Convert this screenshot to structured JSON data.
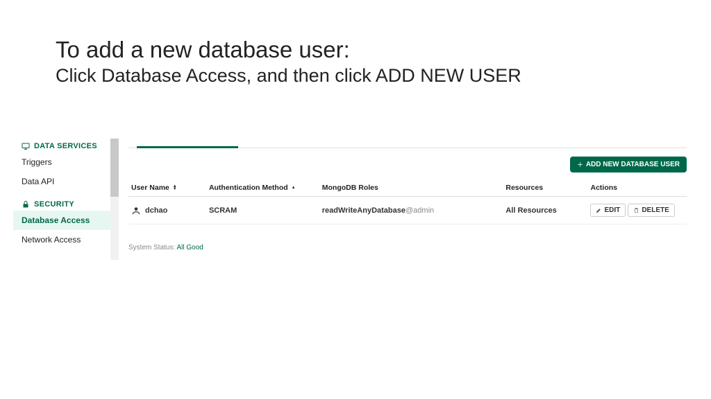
{
  "slide": {
    "title": "To add a new database user:",
    "subtitle": "Click Database Access, and then click ADD NEW USER"
  },
  "sidebar": {
    "sections": [
      {
        "label": "DATA SERVICES",
        "icon": "monitor",
        "items": [
          {
            "label": "Triggers",
            "active": false
          },
          {
            "label": "Data API",
            "active": false
          }
        ]
      },
      {
        "label": "SECURITY",
        "icon": "lock",
        "items": [
          {
            "label": "Database Access",
            "active": true
          },
          {
            "label": "Network Access",
            "active": false
          }
        ]
      }
    ]
  },
  "main": {
    "add_button": "ADD NEW DATABASE USER",
    "columns": {
      "user": "User Name",
      "auth": "Authentication Method",
      "roles": "MongoDB Roles",
      "resources": "Resources",
      "actions": "Actions"
    },
    "rows": [
      {
        "user": "dchao",
        "auth": "SCRAM",
        "role_name": "readWriteAnyDatabase",
        "role_scope": "@admin",
        "resources": "All Resources",
        "edit": "EDIT",
        "delete": "DELETE"
      }
    ],
    "status_label": "System Status:",
    "status_value": "All Good"
  }
}
